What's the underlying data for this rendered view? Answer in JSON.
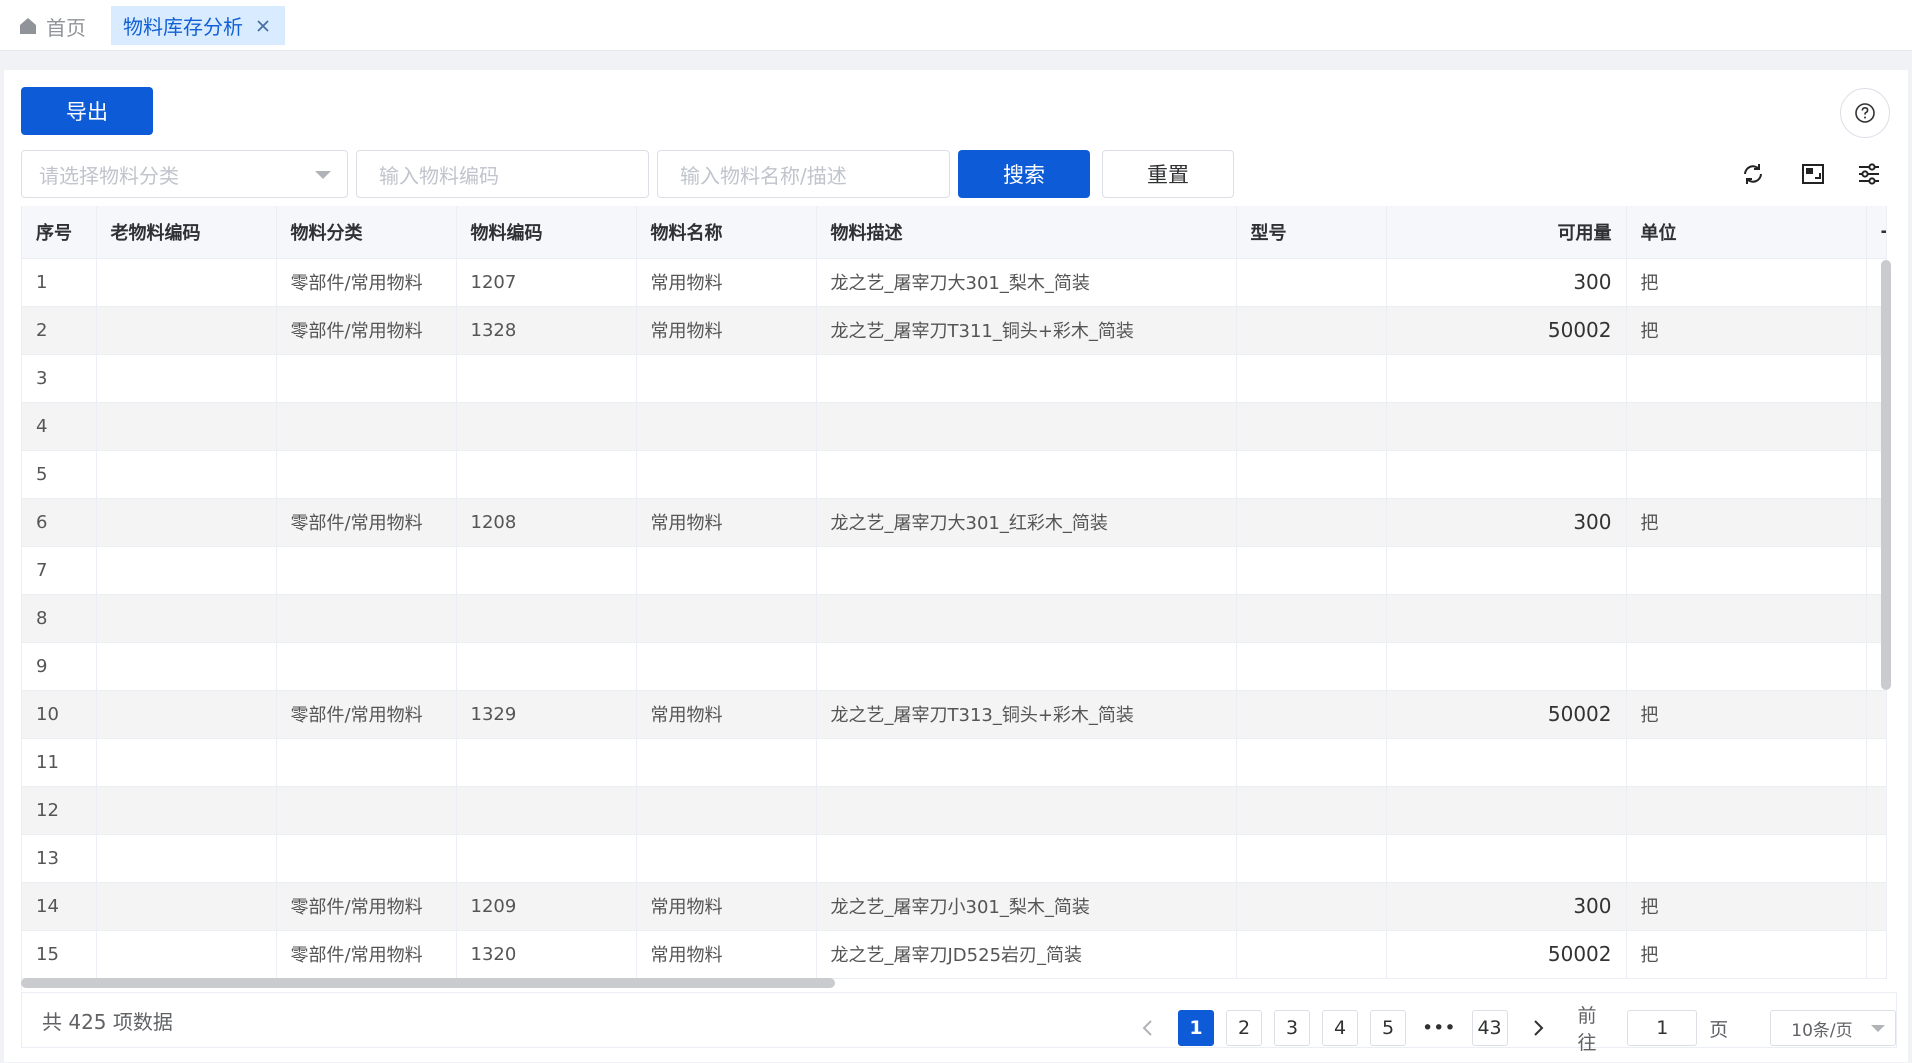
{
  "tabs": {
    "home_label": "首页",
    "active_label": "物料库存分析"
  },
  "toolbar": {
    "export_label": "导出",
    "category_placeholder": "请选择物料分类",
    "code_placeholder": "输入物料编码",
    "name_placeholder": "输入物料名称/描述",
    "search_label": "搜索",
    "reset_label": "重置",
    "icons": [
      "refresh-icon",
      "fullscreen-icon",
      "column-settings-icon",
      "help-icon"
    ]
  },
  "table": {
    "columns": [
      "序号",
      "老物料编码",
      "物料分类",
      "物料编码",
      "物料名称",
      "物料描述",
      "型号",
      "可用量",
      "单位"
    ],
    "rows": [
      {
        "no": "1",
        "old_code": "",
        "category": "零部件/常用物料",
        "code": "1207",
        "name": "常用物料",
        "desc": "龙之艺_屠宰刀大301_梨木_简装",
        "model": "",
        "qty": "300",
        "unit": "把"
      },
      {
        "no": "2",
        "old_code": "",
        "category": "零部件/常用物料",
        "code": "1328",
        "name": "常用物料",
        "desc": "龙之艺_屠宰刀T311_铜头+彩木_简装",
        "model": "",
        "qty": "50002",
        "unit": "把"
      },
      {
        "no": "3",
        "old_code": "",
        "category": "",
        "code": "",
        "name": "",
        "desc": "",
        "model": "",
        "qty": "",
        "unit": ""
      },
      {
        "no": "4",
        "old_code": "",
        "category": "",
        "code": "",
        "name": "",
        "desc": "",
        "model": "",
        "qty": "",
        "unit": ""
      },
      {
        "no": "5",
        "old_code": "",
        "category": "",
        "code": "",
        "name": "",
        "desc": "",
        "model": "",
        "qty": "",
        "unit": ""
      },
      {
        "no": "6",
        "old_code": "",
        "category": "零部件/常用物料",
        "code": "1208",
        "name": "常用物料",
        "desc": "龙之艺_屠宰刀大301_红彩木_简装",
        "model": "",
        "qty": "300",
        "unit": "把"
      },
      {
        "no": "7",
        "old_code": "",
        "category": "",
        "code": "",
        "name": "",
        "desc": "",
        "model": "",
        "qty": "",
        "unit": ""
      },
      {
        "no": "8",
        "old_code": "",
        "category": "",
        "code": "",
        "name": "",
        "desc": "",
        "model": "",
        "qty": "",
        "unit": ""
      },
      {
        "no": "9",
        "old_code": "",
        "category": "",
        "code": "",
        "name": "",
        "desc": "",
        "model": "",
        "qty": "",
        "unit": ""
      },
      {
        "no": "10",
        "old_code": "",
        "category": "零部件/常用物料",
        "code": "1329",
        "name": "常用物料",
        "desc": "龙之艺_屠宰刀T313_铜头+彩木_简装",
        "model": "",
        "qty": "50002",
        "unit": "把"
      },
      {
        "no": "11",
        "old_code": "",
        "category": "",
        "code": "",
        "name": "",
        "desc": "",
        "model": "",
        "qty": "",
        "unit": ""
      },
      {
        "no": "12",
        "old_code": "",
        "category": "",
        "code": "",
        "name": "",
        "desc": "",
        "model": "",
        "qty": "",
        "unit": ""
      },
      {
        "no": "13",
        "old_code": "",
        "category": "",
        "code": "",
        "name": "",
        "desc": "",
        "model": "",
        "qty": "",
        "unit": ""
      },
      {
        "no": "14",
        "old_code": "",
        "category": "零部件/常用物料",
        "code": "1209",
        "name": "常用物料",
        "desc": "龙之艺_屠宰刀小301_梨木_简装",
        "model": "",
        "qty": "300",
        "unit": "把"
      },
      {
        "no": "15",
        "old_code": "",
        "category": "零部件/常用物料",
        "code": "1320",
        "name": "常用物料",
        "desc": "龙之艺_屠宰刀JD525岩刃_简装",
        "model": "",
        "qty": "50002",
        "unit": "把"
      }
    ]
  },
  "pagination": {
    "total_text": "共 425 项数据",
    "pages": [
      "1",
      "2",
      "3",
      "4",
      "5"
    ],
    "ellipsis": "•••",
    "last_page": "43",
    "current_page": "1",
    "goto_label": "前往",
    "goto_value": "1",
    "page_suffix": "页",
    "page_size": "10条/页"
  },
  "colors": {
    "primary": "#0e5bd7",
    "tab_active_bg": "#d9ecff"
  }
}
